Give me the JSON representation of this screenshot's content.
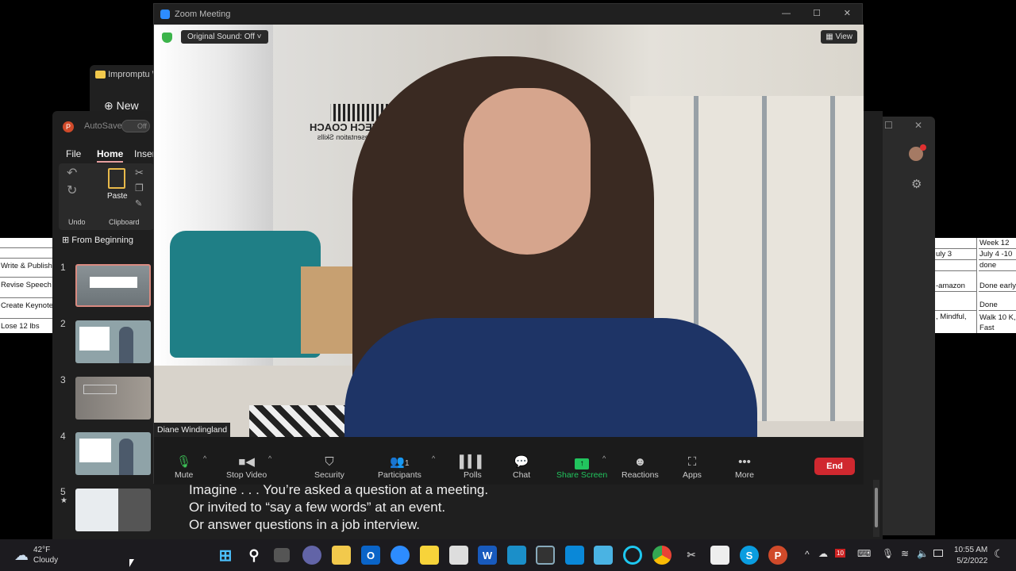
{
  "left_sheet": {
    "rows": [
      "",
      "",
      "Write & Publish",
      "Revise Speech C",
      "Create Keynote r",
      "Lose 12 lbs"
    ]
  },
  "right_sheet": {
    "col1": [
      "",
      "uly 3",
      "",
      "-amazon",
      "",
      ", Mindful,"
    ],
    "col2": [
      "Week 12",
      "July 4 -10",
      "done",
      "Done early",
      "Done",
      "Walk 10 K, Fast"
    ]
  },
  "explorer": {
    "title": "Impromptu W",
    "new_label": "New"
  },
  "ppt": {
    "autosave": "AutoSave",
    "autosave_state": "Off",
    "tabs": [
      "File",
      "Home",
      "Inser"
    ],
    "undo_group": "Undo",
    "clipboard_group": "Clipboard",
    "paste": "Paste",
    "from_beginning": "From Beginning",
    "slides": [
      {
        "n": "1"
      },
      {
        "n": "2"
      },
      {
        "n": "3"
      },
      {
        "n": "4"
      },
      {
        "n": "5",
        "star": "★"
      }
    ],
    "notes": [
      "Imagine . . . You’re asked a question at a meeting.",
      "Or invited to “say a few words” at an event.",
      "Or answer questions in a job interview."
    ]
  },
  "zoom": {
    "title": "Zoom Meeting",
    "original_sound": "Original Sound: Off",
    "view": "View",
    "participant_name": "Diane Windingland",
    "background_logo": [
      "TUAL SPEECH COACH",
      "ing Experts' Presentation Skills"
    ],
    "toolbar": {
      "mute": "Mute",
      "stop_video": "Stop Video",
      "security": "Security",
      "participants": "Participants",
      "participants_count": "1",
      "polls": "Polls",
      "chat": "Chat",
      "share_screen": "Share Screen",
      "reactions": "Reactions",
      "apps": "Apps",
      "more": "More",
      "end": "End"
    },
    "colors": {
      "share": "#22c55e",
      "end": "#d0282f",
      "mic": "#3cc257"
    }
  },
  "taskbar": {
    "temp": "42°F",
    "weather": "Cloudy",
    "time": "10:55 AM",
    "date": "5/2/2022",
    "badge": "10"
  }
}
